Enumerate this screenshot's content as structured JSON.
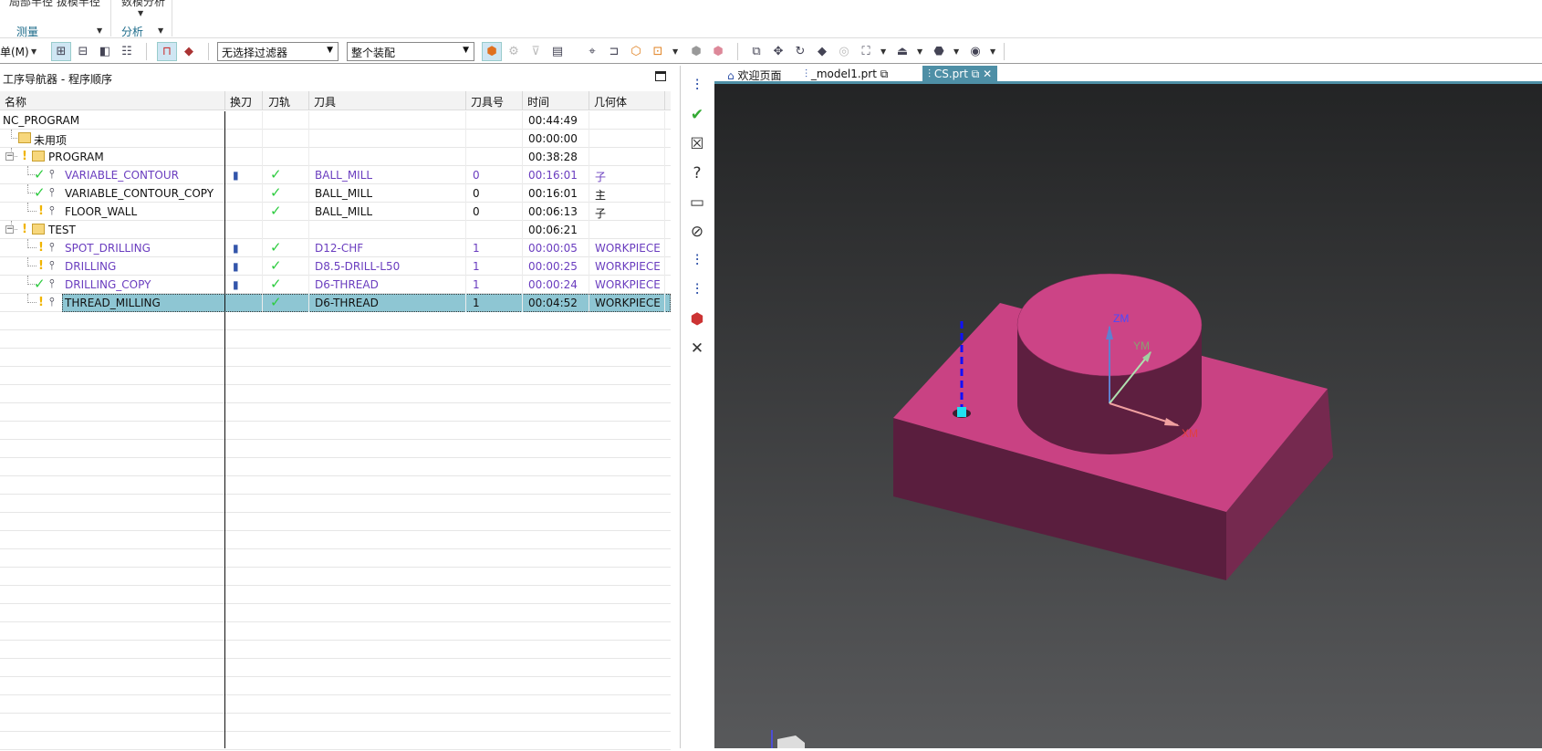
{
  "ribbon": {
    "cut_text_1": "局部半径 拔模半径",
    "cut_text_2": "数模分析",
    "group_measure": "测量",
    "group_analysis": "分析"
  },
  "toolbar": {
    "menu_label": "单(M)",
    "filter_value": "无选择过滤器",
    "assembly_value": "整个装配"
  },
  "navigator": {
    "title": "工序导航器 - 程序顺序",
    "columns": [
      "名称",
      "换刀",
      "刀轨",
      "刀具",
      "刀具号",
      "时间",
      "几何体"
    ],
    "rows": [
      {
        "name": "NC_PROGRAM",
        "level": 0,
        "kind": "root",
        "time": "00:44:49"
      },
      {
        "name": "未用项",
        "level": 1,
        "kind": "folder",
        "time": "00:00:00"
      },
      {
        "name": "PROGRAM",
        "level": 1,
        "kind": "folder",
        "expanded": true,
        "status": "warning",
        "time": "00:38:28"
      },
      {
        "name": "VARIABLE_CONTOUR",
        "level": 2,
        "kind": "op",
        "status": "ok",
        "purple": true,
        "tool_change": "tool-change-icon",
        "path": "ok",
        "tool": "BALL_MILL",
        "tool_no": "0",
        "time": "00:16:01",
        "geom": "子"
      },
      {
        "name": "VARIABLE_CONTOUR_COPY",
        "level": 2,
        "kind": "op",
        "status": "ok",
        "purple": false,
        "tool_change": "",
        "path": "ok",
        "tool": "BALL_MILL",
        "tool_no": "0",
        "time": "00:16:01",
        "geom": "主"
      },
      {
        "name": "FLOOR_WALL",
        "level": 2,
        "kind": "op",
        "status": "warning",
        "purple": false,
        "tool_change": "",
        "path": "ok",
        "tool": "BALL_MILL",
        "tool_no": "0",
        "time": "00:06:13",
        "geom": "子"
      },
      {
        "name": "TEST",
        "level": 1,
        "kind": "folder",
        "expanded": true,
        "status": "warning",
        "time": "00:06:21"
      },
      {
        "name": "SPOT_DRILLING",
        "level": 2,
        "kind": "op",
        "status": "warning",
        "purple": true,
        "tool_change": "tool-change-icon",
        "path": "ok",
        "tool": "D12-CHF",
        "tool_no": "1",
        "time": "00:00:05",
        "geom": "WORKPIECE"
      },
      {
        "name": "DRILLING",
        "level": 2,
        "kind": "op",
        "status": "warning",
        "purple": true,
        "tool_change": "drill-icon",
        "path": "ok",
        "tool": "D8.5-DRILL-L50",
        "tool_no": "1",
        "time": "00:00:25",
        "geom": "WORKPIECE"
      },
      {
        "name": "DRILLING_COPY",
        "level": 2,
        "kind": "op",
        "status": "ok",
        "purple": true,
        "tool_change": "drill-icon",
        "path": "ok",
        "tool": "D6-THREAD",
        "tool_no": "1",
        "time": "00:00:24",
        "geom": "WORKPIECE"
      },
      {
        "name": "THREAD_MILLING",
        "level": 2,
        "kind": "op",
        "status": "warning",
        "purple": false,
        "selected": true,
        "tool_change": "",
        "path": "ok",
        "tool": "D6-THREAD",
        "tool_no": "1",
        "time": "00:04:52",
        "geom": "WORKPIECE"
      }
    ]
  },
  "tabs": [
    {
      "label": "欢迎页面",
      "icon": "home-icon"
    },
    {
      "label": "_model1.prt",
      "icon": "part-icon"
    },
    {
      "label": "CS.prt",
      "icon": "part-icon",
      "active": true
    }
  ],
  "viewport": {
    "axis_z": "ZM",
    "axis_y": "YM",
    "axis_x": "XM",
    "part_color": "#c94283",
    "accent": "#4e8fa6"
  }
}
